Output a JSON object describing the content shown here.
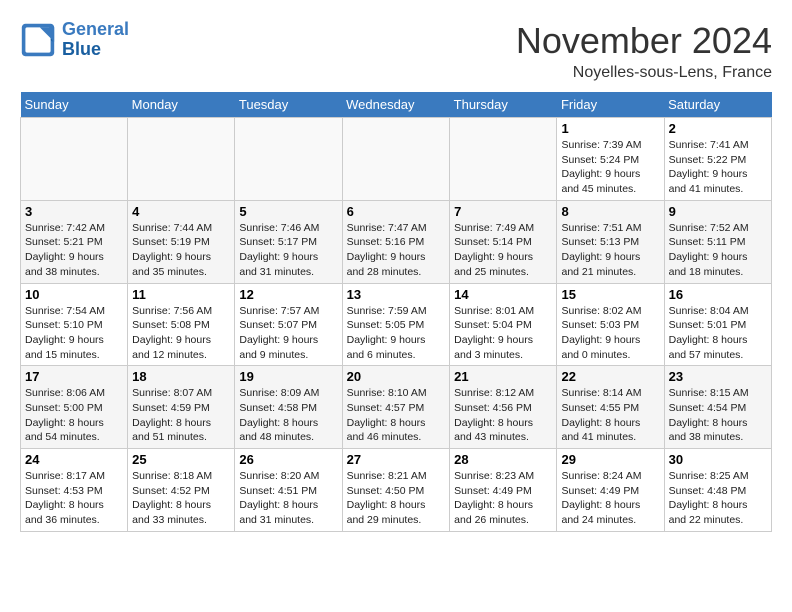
{
  "header": {
    "logo_line1": "General",
    "logo_line2": "Blue",
    "month": "November 2024",
    "location": "Noyelles-sous-Lens, France"
  },
  "weekdays": [
    "Sunday",
    "Monday",
    "Tuesday",
    "Wednesday",
    "Thursday",
    "Friday",
    "Saturday"
  ],
  "weeks": [
    [
      {
        "day": "",
        "info": ""
      },
      {
        "day": "",
        "info": ""
      },
      {
        "day": "",
        "info": ""
      },
      {
        "day": "",
        "info": ""
      },
      {
        "day": "",
        "info": ""
      },
      {
        "day": "1",
        "info": "Sunrise: 7:39 AM\nSunset: 5:24 PM\nDaylight: 9 hours\nand 45 minutes."
      },
      {
        "day": "2",
        "info": "Sunrise: 7:41 AM\nSunset: 5:22 PM\nDaylight: 9 hours\nand 41 minutes."
      }
    ],
    [
      {
        "day": "3",
        "info": "Sunrise: 7:42 AM\nSunset: 5:21 PM\nDaylight: 9 hours\nand 38 minutes."
      },
      {
        "day": "4",
        "info": "Sunrise: 7:44 AM\nSunset: 5:19 PM\nDaylight: 9 hours\nand 35 minutes."
      },
      {
        "day": "5",
        "info": "Sunrise: 7:46 AM\nSunset: 5:17 PM\nDaylight: 9 hours\nand 31 minutes."
      },
      {
        "day": "6",
        "info": "Sunrise: 7:47 AM\nSunset: 5:16 PM\nDaylight: 9 hours\nand 28 minutes."
      },
      {
        "day": "7",
        "info": "Sunrise: 7:49 AM\nSunset: 5:14 PM\nDaylight: 9 hours\nand 25 minutes."
      },
      {
        "day": "8",
        "info": "Sunrise: 7:51 AM\nSunset: 5:13 PM\nDaylight: 9 hours\nand 21 minutes."
      },
      {
        "day": "9",
        "info": "Sunrise: 7:52 AM\nSunset: 5:11 PM\nDaylight: 9 hours\nand 18 minutes."
      }
    ],
    [
      {
        "day": "10",
        "info": "Sunrise: 7:54 AM\nSunset: 5:10 PM\nDaylight: 9 hours\nand 15 minutes."
      },
      {
        "day": "11",
        "info": "Sunrise: 7:56 AM\nSunset: 5:08 PM\nDaylight: 9 hours\nand 12 minutes."
      },
      {
        "day": "12",
        "info": "Sunrise: 7:57 AM\nSunset: 5:07 PM\nDaylight: 9 hours\nand 9 minutes."
      },
      {
        "day": "13",
        "info": "Sunrise: 7:59 AM\nSunset: 5:05 PM\nDaylight: 9 hours\nand 6 minutes."
      },
      {
        "day": "14",
        "info": "Sunrise: 8:01 AM\nSunset: 5:04 PM\nDaylight: 9 hours\nand 3 minutes."
      },
      {
        "day": "15",
        "info": "Sunrise: 8:02 AM\nSunset: 5:03 PM\nDaylight: 9 hours\nand 0 minutes."
      },
      {
        "day": "16",
        "info": "Sunrise: 8:04 AM\nSunset: 5:01 PM\nDaylight: 8 hours\nand 57 minutes."
      }
    ],
    [
      {
        "day": "17",
        "info": "Sunrise: 8:06 AM\nSunset: 5:00 PM\nDaylight: 8 hours\nand 54 minutes."
      },
      {
        "day": "18",
        "info": "Sunrise: 8:07 AM\nSunset: 4:59 PM\nDaylight: 8 hours\nand 51 minutes."
      },
      {
        "day": "19",
        "info": "Sunrise: 8:09 AM\nSunset: 4:58 PM\nDaylight: 8 hours\nand 48 minutes."
      },
      {
        "day": "20",
        "info": "Sunrise: 8:10 AM\nSunset: 4:57 PM\nDaylight: 8 hours\nand 46 minutes."
      },
      {
        "day": "21",
        "info": "Sunrise: 8:12 AM\nSunset: 4:56 PM\nDaylight: 8 hours\nand 43 minutes."
      },
      {
        "day": "22",
        "info": "Sunrise: 8:14 AM\nSunset: 4:55 PM\nDaylight: 8 hours\nand 41 minutes."
      },
      {
        "day": "23",
        "info": "Sunrise: 8:15 AM\nSunset: 4:54 PM\nDaylight: 8 hours\nand 38 minutes."
      }
    ],
    [
      {
        "day": "24",
        "info": "Sunrise: 8:17 AM\nSunset: 4:53 PM\nDaylight: 8 hours\nand 36 minutes."
      },
      {
        "day": "25",
        "info": "Sunrise: 8:18 AM\nSunset: 4:52 PM\nDaylight: 8 hours\nand 33 minutes."
      },
      {
        "day": "26",
        "info": "Sunrise: 8:20 AM\nSunset: 4:51 PM\nDaylight: 8 hours\nand 31 minutes."
      },
      {
        "day": "27",
        "info": "Sunrise: 8:21 AM\nSunset: 4:50 PM\nDaylight: 8 hours\nand 29 minutes."
      },
      {
        "day": "28",
        "info": "Sunrise: 8:23 AM\nSunset: 4:49 PM\nDaylight: 8 hours\nand 26 minutes."
      },
      {
        "day": "29",
        "info": "Sunrise: 8:24 AM\nSunset: 4:49 PM\nDaylight: 8 hours\nand 24 minutes."
      },
      {
        "day": "30",
        "info": "Sunrise: 8:25 AM\nSunset: 4:48 PM\nDaylight: 8 hours\nand 22 minutes."
      }
    ]
  ]
}
